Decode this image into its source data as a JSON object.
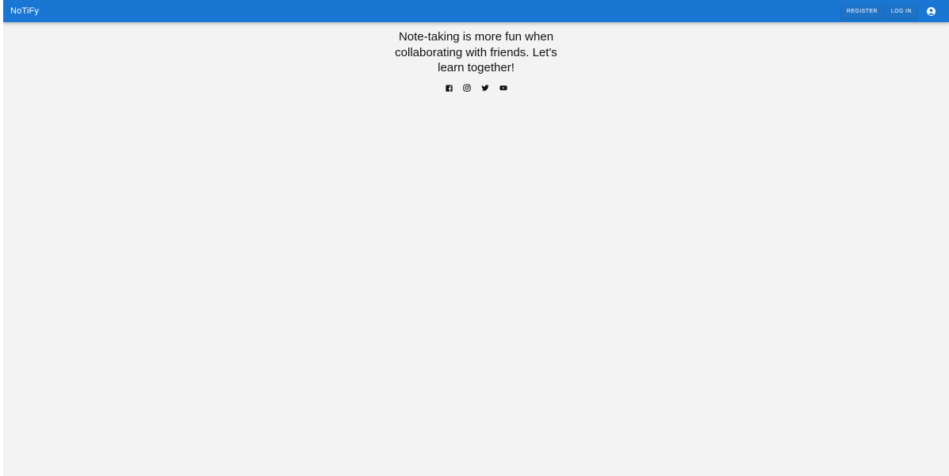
{
  "header": {
    "brand": "NoTiFy",
    "register_label": "REGISTER",
    "login_label": "LOG IN",
    "account_icon": "account-circle-icon"
  },
  "hero": {
    "tagline": "Note-taking is more fun when collaborating with friends. Let's learn together!"
  },
  "socials": [
    {
      "icon": "facebook-icon"
    },
    {
      "icon": "instagram-icon"
    },
    {
      "icon": "twitter-icon"
    },
    {
      "icon": "youtube-icon"
    }
  ],
  "colors": {
    "appbar": "#1976d2",
    "background": "#f3f3f3",
    "text": "#111111"
  }
}
